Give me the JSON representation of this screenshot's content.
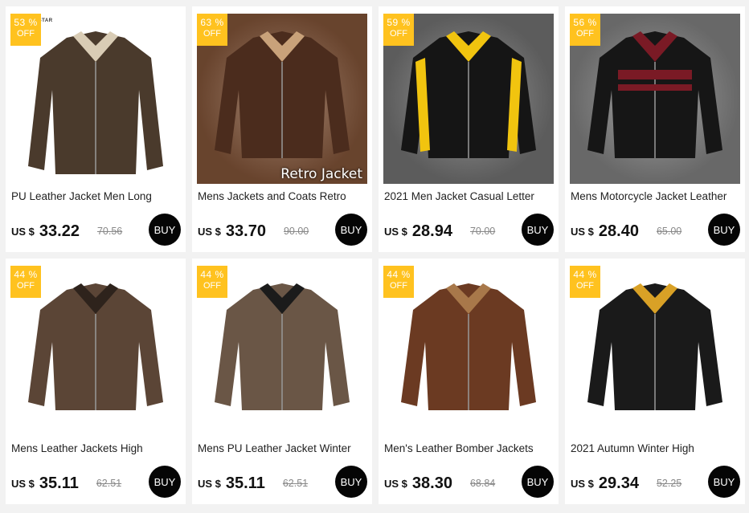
{
  "products": [
    {
      "discount_pct": "53 %",
      "discount_off": "OFF",
      "title": "PU Leather Jacket Men Long",
      "currency": "US $",
      "price": "33.22",
      "old_price": "70.56",
      "buy_label": "BUY",
      "img_text": "E STAR",
      "bg": "#ffffff",
      "jacket": "#4a3a2c",
      "accent": "#d9ccb5"
    },
    {
      "discount_pct": "63 %",
      "discount_off": "OFF",
      "title": "Mens Jackets and Coats Retro",
      "currency": "US $",
      "price": "33.70",
      "old_price": "90.00",
      "buy_label": "BUY",
      "img_text": "Retro Jacket",
      "bg": "#8b5a3c",
      "jacket": "#4b2c1d",
      "accent": "#c9a27a"
    },
    {
      "discount_pct": "59 %",
      "discount_off": "OFF",
      "title": "2021 Men Jacket Casual Letter",
      "currency": "US $",
      "price": "28.94",
      "old_price": "70.00",
      "buy_label": "BUY",
      "img_text": "",
      "bg": "#7a7a7a",
      "jacket": "#151515",
      "accent": "#f1c40f"
    },
    {
      "discount_pct": "56 %",
      "discount_off": "OFF",
      "title": "Mens Motorcycle Jacket Leather",
      "currency": "US $",
      "price": "28.40",
      "old_price": "65.00",
      "buy_label": "BUY",
      "img_text": "",
      "bg": "#8a8a8a",
      "jacket": "#161616",
      "accent": "#7a1a25"
    },
    {
      "discount_pct": "44 %",
      "discount_off": "OFF",
      "title": "Mens Leather Jackets High",
      "currency": "US $",
      "price": "35.11",
      "old_price": "62.51",
      "buy_label": "BUY",
      "img_text": "",
      "bg": "#ffffff",
      "jacket": "#5b4536",
      "accent": "#2e231c"
    },
    {
      "discount_pct": "44 %",
      "discount_off": "OFF",
      "title": "Mens PU Leather Jacket Winter",
      "currency": "US $",
      "price": "35.11",
      "old_price": "62.51",
      "buy_label": "BUY",
      "img_text": "",
      "bg": "#ffffff",
      "jacket": "#6a5646",
      "accent": "#1b1b1b"
    },
    {
      "discount_pct": "44 %",
      "discount_off": "OFF",
      "title": "Men's Leather Bomber Jackets",
      "currency": "US $",
      "price": "38.30",
      "old_price": "68.84",
      "buy_label": "BUY",
      "img_text": "",
      "bg": "#ffffff",
      "jacket": "#6b3a22",
      "accent": "#a8784a"
    },
    {
      "discount_pct": "44 %",
      "discount_off": "OFF",
      "title": "2021 Autumn Winter High",
      "currency": "US $",
      "price": "29.34",
      "old_price": "52.25",
      "buy_label": "BUY",
      "img_text": "",
      "bg": "#ffffff",
      "jacket": "#1a1a1a",
      "accent": "#d9a126"
    }
  ]
}
